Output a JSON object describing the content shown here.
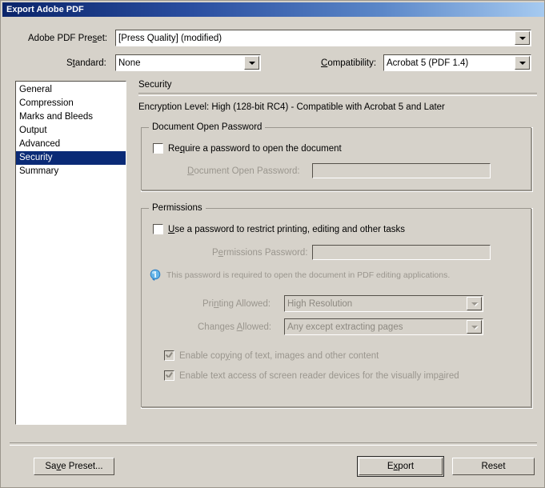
{
  "window": {
    "title": "Export Adobe PDF"
  },
  "top": {
    "preset_label": "Adobe PDF Preset:",
    "preset_value": "[Press Quality] (modified)",
    "standard_label": "Standard:",
    "standard_value": "None",
    "compatibility_label": "Compatibility:",
    "compatibility_value": "Acrobat 5 (PDF 1.4)"
  },
  "sidebar": {
    "items": [
      {
        "label": "General",
        "selected": false
      },
      {
        "label": "Compression",
        "selected": false
      },
      {
        "label": "Marks and Bleeds",
        "selected": false
      },
      {
        "label": "Output",
        "selected": false
      },
      {
        "label": "Advanced",
        "selected": false
      },
      {
        "label": "Security",
        "selected": true
      },
      {
        "label": "Summary",
        "selected": false
      }
    ]
  },
  "panel": {
    "heading": "Security",
    "encryption_text": "Encryption Level: High (128-bit RC4) - Compatible with Acrobat 5 and Later",
    "document_open_password": {
      "caption": "Document Open Password",
      "require_checkbox_label": "Require a password to open the document",
      "require_checkbox_checked": false,
      "password_label": "Document Open Password:",
      "password_value": "",
      "password_disabled": true
    },
    "permissions": {
      "caption": "Permissions",
      "use_password_checkbox_label": "Use a password to restrict printing, editing and other tasks",
      "use_password_checkbox_checked": false,
      "password_label": "Permissions Password:",
      "password_value": "",
      "password_disabled": true,
      "info_icon": "info-icon",
      "info_text": "This password is required to open the document in PDF editing applications.",
      "printing_label": "Printing Allowed:",
      "printing_value": "High Resolution",
      "changes_label": "Changes Allowed:",
      "changes_value": "Any except extracting pages",
      "enable_copy_label": "Enable copying of text, images and other content",
      "enable_copy_checked": true,
      "enable_screenreader_label": "Enable text access of screen reader devices for the visually impaired",
      "enable_screenreader_checked": true
    }
  },
  "footer": {
    "save_preset": "Save Preset...",
    "export": "Export",
    "reset": "Reset"
  },
  "colors": {
    "dialog_bg": "#d6d2ca",
    "title_start": "#0a246a",
    "title_end": "#a6caf0",
    "selection": "#0a2a76",
    "disabled_text": "#9a968e",
    "info_blue": "#3a8fd4"
  }
}
